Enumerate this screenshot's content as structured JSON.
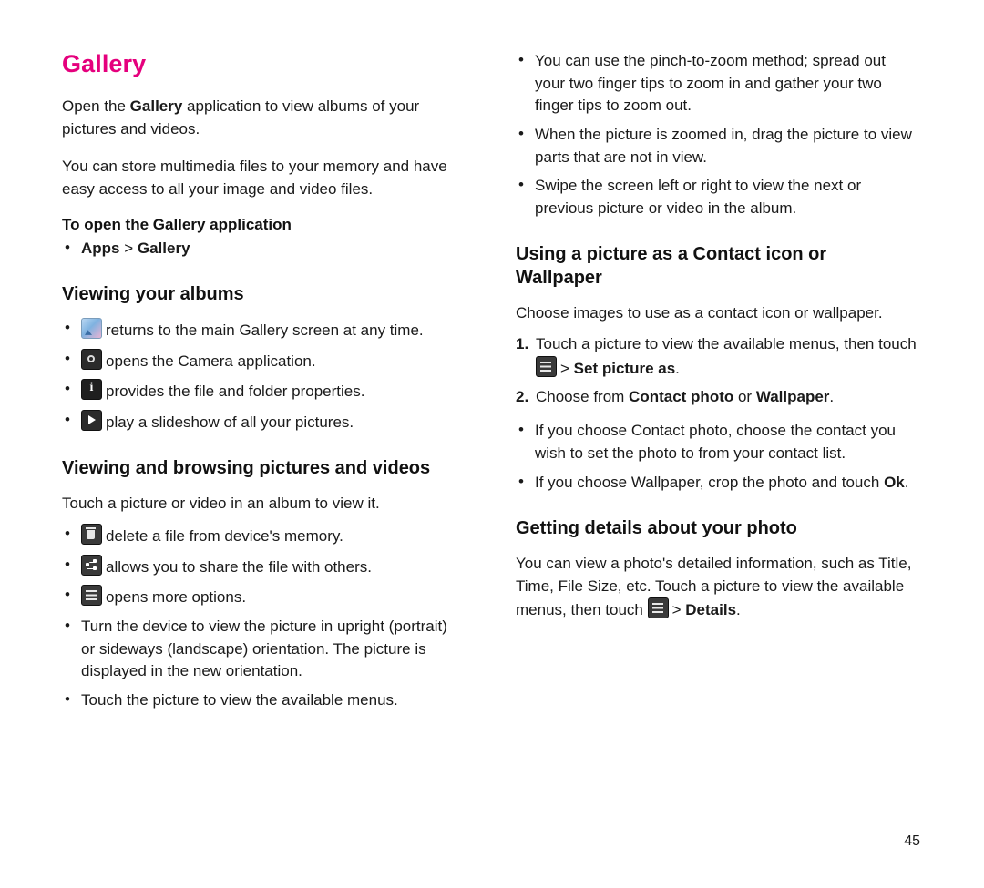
{
  "page": {
    "number": "45"
  },
  "left": {
    "title": "Gallery",
    "intro_1_a": "Open the ",
    "intro_1_b": "Gallery",
    "intro_1_c": " application to view albums of your pictures and videos.",
    "intro_2": "You can store multimedia files to your memory and have easy access to all your image and video files.",
    "heading_open": "To open the Gallery application",
    "open_bullet_a": "Apps",
    "open_bullet_sep": " > ",
    "open_bullet_b": "Gallery",
    "heading_viewing_albums": "Viewing your albums",
    "album_bullets": [
      {
        "icon": "gallery-icon",
        "text": "returns to the main Gallery screen at any time."
      },
      {
        "icon": "camera-icon",
        "text": "opens the Camera application."
      },
      {
        "icon": "info-icon",
        "text": "provides the file and folder properties."
      },
      {
        "icon": "play-icon",
        "text": "play a slideshow of all your pictures."
      }
    ],
    "heading_browsing": "Viewing and browsing pictures and videos",
    "browsing_intro": "Touch a picture or video in an album to view it.",
    "browsing_icon_bullets": [
      {
        "icon": "trash-icon",
        "text": "delete a file from device's memory."
      },
      {
        "icon": "share-icon",
        "text": "allows you to share the file with others."
      },
      {
        "icon": "menu-icon",
        "text": "opens more options."
      }
    ],
    "browsing_bullets": [
      "Turn the device to view the picture in upright (portrait) or sideways (landscape) orientation. The picture is displayed in the new orientation.",
      "Touch the picture to view the available menus."
    ]
  },
  "right": {
    "top_bullets": [
      "You can use the pinch-to-zoom method; spread out your two finger tips to zoom in and gather your two finger tips to zoom out.",
      "When the picture is zoomed in, drag the picture to view parts that are not in view.",
      "Swipe the screen left or right to view the next or previous picture or video in the album."
    ],
    "heading_contact": "Using a picture as a Contact icon or Wallpaper",
    "contact_intro": "Choose images to use as a contact icon or wallpaper.",
    "step1_num": "1.",
    "step1_a": "Touch a picture to view the available menus, then touch",
    "step1_sep": ">",
    "step1_b": "Set picture as",
    "step1_end": ".",
    "step2_num": "2.",
    "step2_a": "Choose from ",
    "step2_b": "Contact photo",
    "step2_c": " or ",
    "step2_d": "Wallpaper",
    "step2_end": ".",
    "contact_bullets": [
      {
        "text_a": "If you choose Contact photo, choose the contact you wish to set the photo to from your contact list.",
        "bold": "",
        "text_b": ""
      },
      {
        "text_a": "If you choose Wallpaper, crop the photo and touch ",
        "bold": "Ok",
        "text_b": "."
      }
    ],
    "heading_details": "Getting details about your photo",
    "details_a": "You can view a photo's detailed information, such as Title, Time, File Size, etc. Touch a picture to view the available menus, then touch",
    "details_sep": ">",
    "details_b": "Details",
    "details_end": "."
  }
}
